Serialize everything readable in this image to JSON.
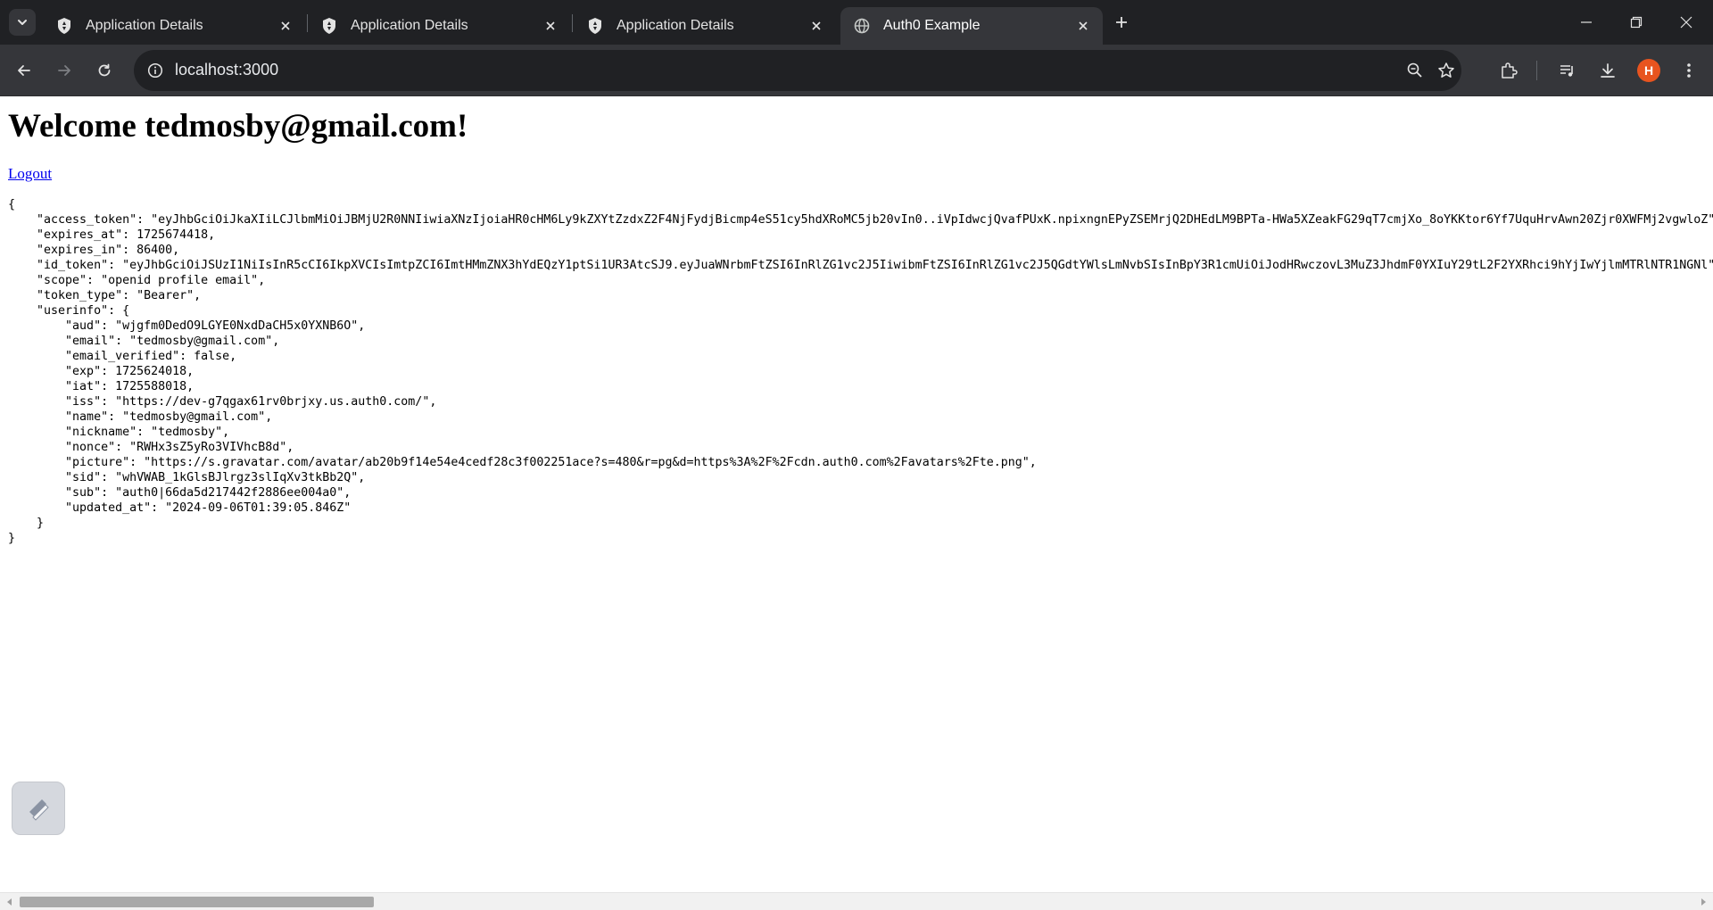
{
  "tabs": [
    {
      "title": "Application Details",
      "favicon": "shield-icon",
      "active": false
    },
    {
      "title": "Application Details",
      "favicon": "shield-icon",
      "active": false
    },
    {
      "title": "Application Details",
      "favicon": "shield-icon",
      "active": false
    },
    {
      "title": "Auth0 Example",
      "favicon": "globe-icon",
      "active": true
    }
  ],
  "toolbar": {
    "url": "localhost:3000",
    "profile_initial": "H"
  },
  "colors": {
    "chrome_dark": "#202124",
    "chrome_toolbar": "#35363a",
    "link": "#0000ee",
    "profile": "#e8541f"
  },
  "page": {
    "heading": "Welcome tedmosby@gmail.com!",
    "logout_label": "Logout",
    "json_text": "{\n    \"access_token\": \"eyJhbGciOiJkaXIiLCJlbmMiOiJBMjU2R0NNIiwiaXNzIjoiaHR0cHM6Ly9kZXYtZzdxZ2F4NjFydjBicmp4eS51cy5hdXRoMC5jb20vIn0..iVpIdwcjQvafPUxK.npixngnEPyZSEMrjQ2DHEdLM9BPTa-HWa5XZeakFG29qT7cmjXo_8oYKKtor6Yf7UquHrvAwn20Zjr0XWFMj2vgwloZ\",\n    \"expires_at\": 1725674418,\n    \"expires_in\": 86400,\n    \"id_token\": \"eyJhbGciOiJSUzI1NiIsInR5cCI6IkpXVCIsImtpZCI6ImtHMmZNX3hYdEQzY1ptSi1UR3AtcSJ9.eyJuaWNrbmFtZSI6InRlZG1vc2J5IiwibmFtZSI6InRlZG1vc2J5QGdtYWlsLmNvbSIsInBpY3R1cmUiOiJodHRwczovL3MuZ3JhdmF0YXIuY29tL2F2YXRhci9hYjIwYjlmMTRlNTR1NGNl\",\n    \"scope\": \"openid profile email\",\n    \"token_type\": \"Bearer\",\n    \"userinfo\": {\n        \"aud\": \"wjgfm0DedO9LGYE0NxdDaCH5x0YXNB6O\",\n        \"email\": \"tedmosby@gmail.com\",\n        \"email_verified\": false,\n        \"exp\": 1725624018,\n        \"iat\": 1725588018,\n        \"iss\": \"https://dev-g7qgax61rv0brjxy.us.auth0.com/\",\n        \"name\": \"tedmosby@gmail.com\",\n        \"nickname\": \"tedmosby\",\n        \"nonce\": \"RWHx3sZ5yRo3VIVhcB8d\",\n        \"picture\": \"https://s.gravatar.com/avatar/ab20b9f14e54e4cedf28c3f002251ace?s=480&r=pg&d=https%3A%2F%2Fcdn.auth0.com%2Favatars%2Fte.png\",\n        \"sid\": \"whVWAB_1kGlsBJlrgz3slIqXv3tkBb2Q\",\n        \"sub\": \"auth0|66da5d217442f2886ee004a0\",\n        \"updated_at\": \"2024-09-06T01:39:05.846Z\"\n    }\n}"
  }
}
